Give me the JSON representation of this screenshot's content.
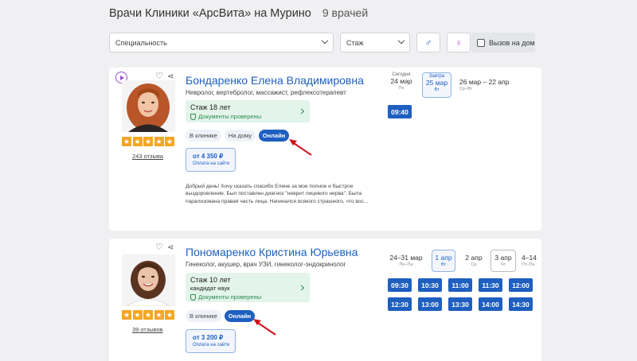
{
  "header": {
    "title": "Врачи Клиники «АрсВита» на Мурино",
    "count": "9 врачей"
  },
  "filters": {
    "specialty": "Специальность",
    "experience": "Стаж",
    "male_icon": "♂",
    "female_icon": "♀",
    "home_call": "Вызов на дом"
  },
  "doctors": [
    {
      "name": "Бондаренко Елена Владимировна",
      "specialties": "Невролог, вертебролог, массажист, рефлексотерапевт",
      "experience": "Стаж 18 лет",
      "docs": "Документы проверены",
      "rating_stars": 5,
      "reviews": "243 отзыва",
      "modes": [
        "В клинике",
        "На дому",
        "Онлайн"
      ],
      "price": "от 4 350 ₽",
      "price_note": "Оплата на сайте",
      "review_text": "Добрый день! Хочу сказать спасибо Елене за мое полное и быстрое выздоровление. Был поставлен диагноз \"неврит лицевого нерва\". Была парализована правая часть лица. Начинался всякого страшного, что вос...",
      "days": [
        {
          "top": "Сегодня",
          "main": "24 мар",
          "sub": "Пн"
        },
        {
          "top": "Завтра",
          "main": "25 мар",
          "sub": "Вт"
        },
        {
          "top": "",
          "main": "26 мар – 22 апр",
          "sub": "Ср–Вт"
        }
      ],
      "slots": [
        "09:40"
      ]
    },
    {
      "name": "Пономаренко Кристина Юрьевна",
      "specialties": "Гинеколог, акушер, врач УЗИ, гинеколог-эндокринолог",
      "experience": "Стаж 10 лет",
      "degree": "кандидат наук",
      "docs": "Документы проверены",
      "rating_stars": 5,
      "reviews": "39 отзывов",
      "modes": [
        "В клинике",
        "Онлайн"
      ],
      "price": "от 3 200 ₽",
      "price_note": "Оплата на сайте",
      "days": [
        {
          "main": "24–31 мар",
          "sub": "Пн–Пн"
        },
        {
          "main": "1 апр",
          "sub": "Вт"
        },
        {
          "main": "2 апр",
          "sub": "Ср"
        },
        {
          "main": "3 апр",
          "sub": "Чт"
        },
        {
          "main": "4–14",
          "sub": "Пт–Пн"
        }
      ],
      "slots": [
        "09:30",
        "10:30",
        "11:00",
        "11:30",
        "12:00",
        "12:30",
        "13:00",
        "13:30",
        "14:00",
        "14:30"
      ]
    }
  ],
  "colors": {
    "accent": "#1e5fc0",
    "star": "#f5a623",
    "success": "#2a8a50",
    "arrow": "#d0121b"
  }
}
